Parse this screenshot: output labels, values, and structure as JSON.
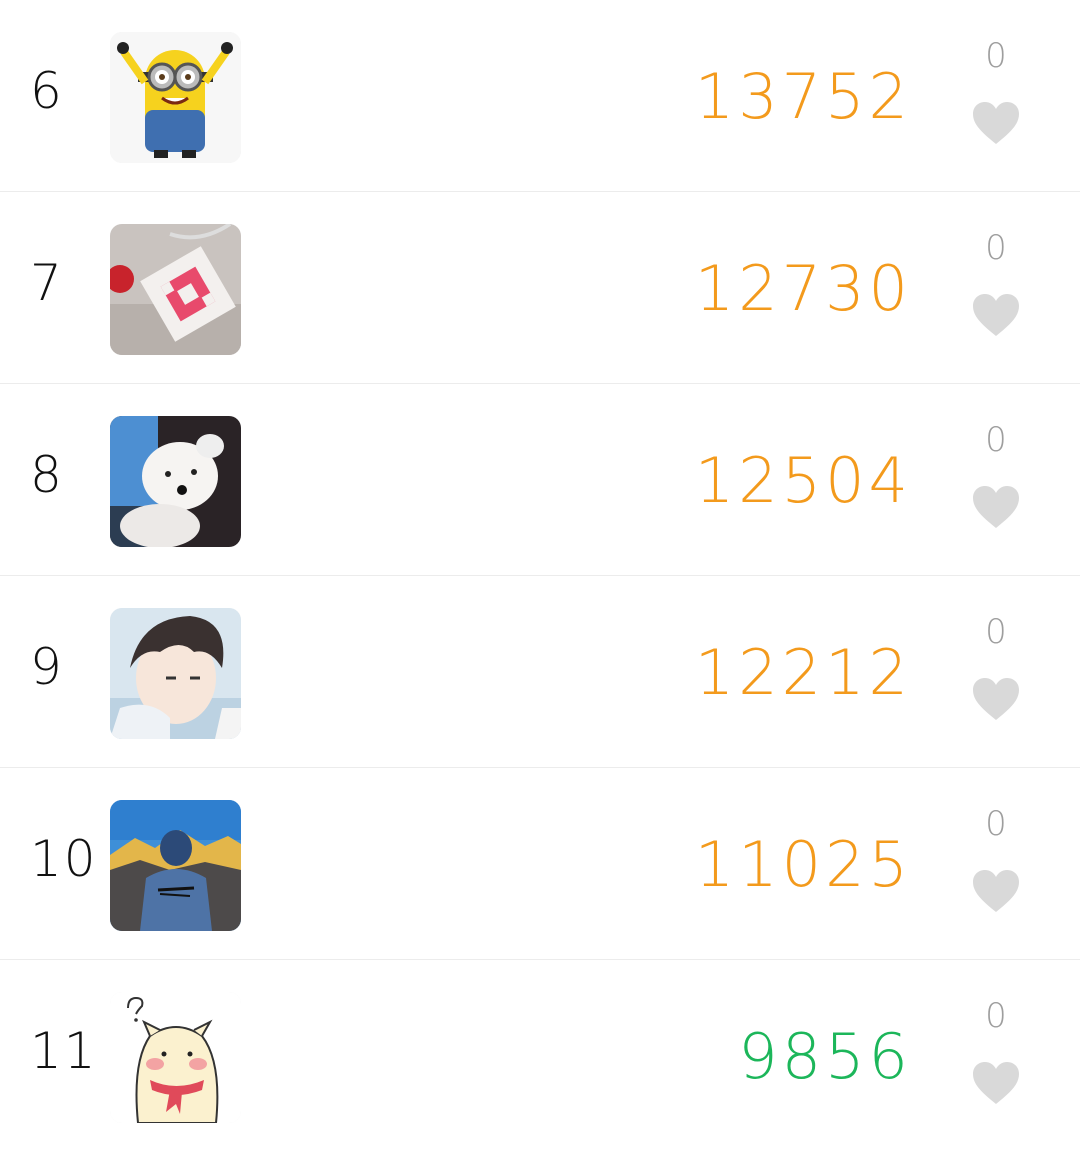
{
  "colors": {
    "steps_high": "#f39a1c",
    "steps_low": "#1cb65a",
    "heart": "#d9d9d9",
    "like_count": "#9e9e9e"
  },
  "rows": [
    {
      "rank": "6",
      "avatar": "minion-avatar",
      "steps": "13752",
      "steps_color": "#f39a1c",
      "likes": "0"
    },
    {
      "rank": "7",
      "avatar": "cross-stitch-keychain-avatar",
      "steps": "12730",
      "steps_color": "#f39a1c",
      "likes": "0"
    },
    {
      "rank": "8",
      "avatar": "white-puppy-avatar",
      "steps": "12504",
      "steps_color": "#f39a1c",
      "likes": "0"
    },
    {
      "rank": "9",
      "avatar": "anime-boy-avatar",
      "steps": "12212",
      "steps_color": "#f39a1c",
      "likes": "0"
    },
    {
      "rank": "10",
      "avatar": "hooded-person-mountains-avatar",
      "steps": "11025",
      "steps_color": "#f39a1c",
      "likes": "0"
    },
    {
      "rank": "11",
      "avatar": "cartoon-hamster-avatar",
      "steps": "9856",
      "steps_color": "#1cb65a",
      "likes": "0"
    }
  ]
}
